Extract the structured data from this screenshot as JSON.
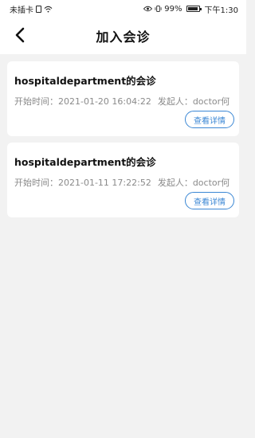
{
  "status_bar": {
    "carrier": "未插卡",
    "battery": "99%",
    "battery_level": 0.99,
    "time": "下午1:30"
  },
  "nav": {
    "title": "加入会诊"
  },
  "consultations": [
    {
      "title": "hospitaldepartment的会诊",
      "start_time": "开始时间：2021-01-20 16:04:22",
      "initiator": "发起人：doctor何",
      "button": "查看详情"
    },
    {
      "title": "hospitaldepartment的会诊",
      "start_time": "开始时间：2021-01-11 17:22:52",
      "initiator": "发起人：doctor何",
      "button": "查看详情"
    }
  ],
  "colors": {
    "accent": "#3b87d4",
    "background": "#f2f2f2"
  }
}
